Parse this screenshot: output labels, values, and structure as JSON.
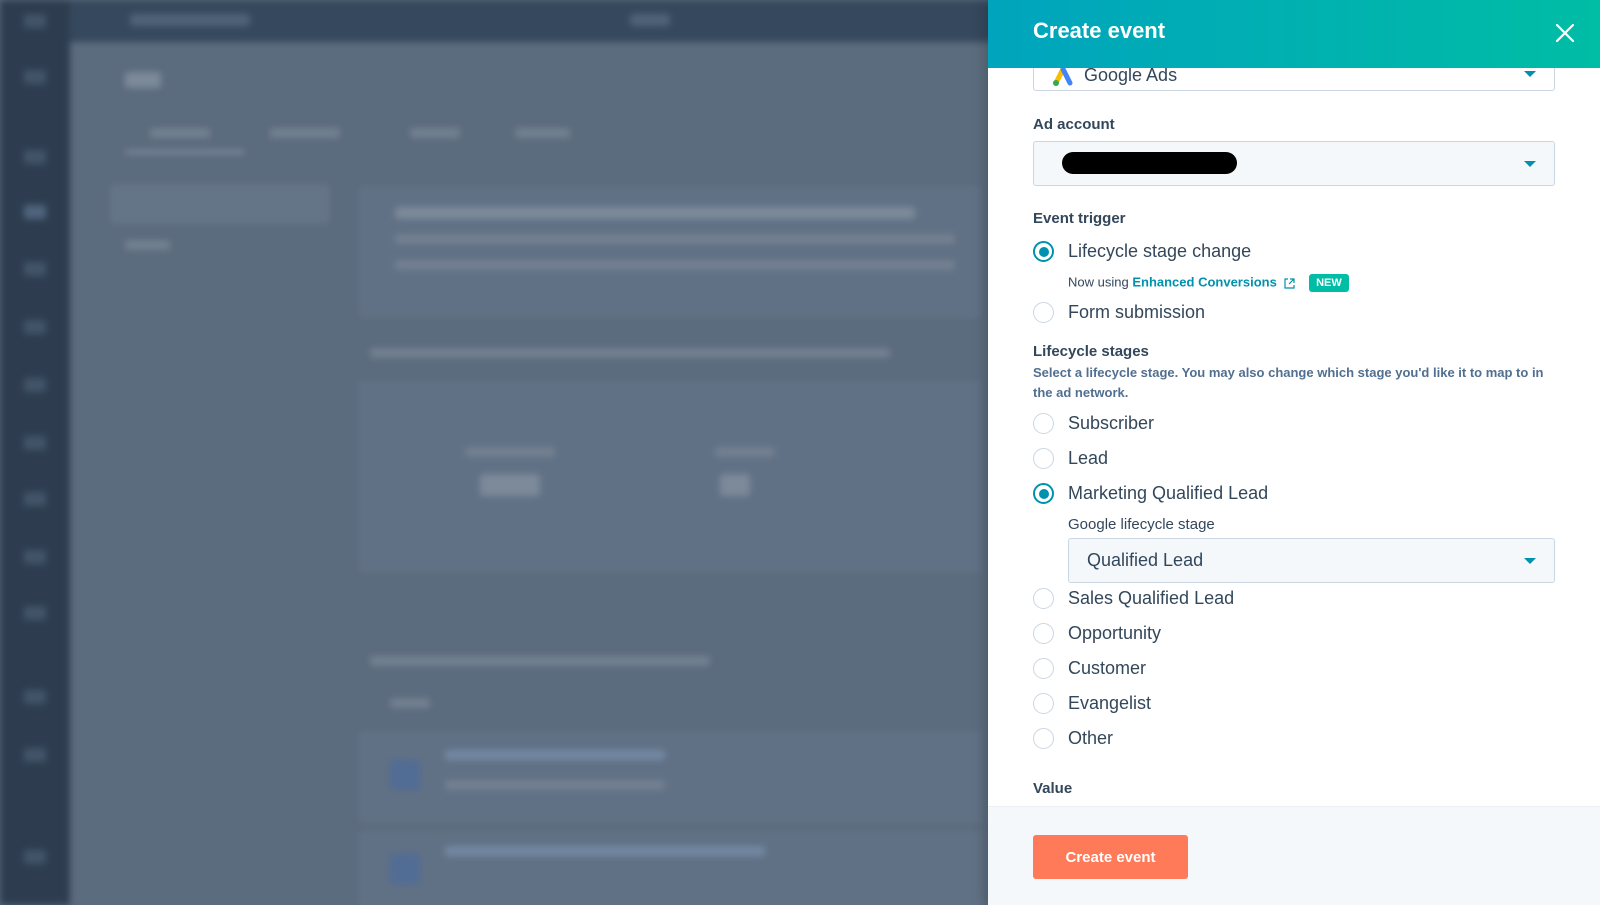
{
  "panel": {
    "title": "Create event",
    "ad_network_value": "Google Ads",
    "ad_account_label": "Ad account",
    "event_trigger_label": "Event trigger",
    "triggers": [
      {
        "label": "Lifecycle stage change",
        "checked": true
      },
      {
        "label": "Form submission",
        "checked": false
      }
    ],
    "enhanced_note": {
      "prefix": "Now using",
      "link": "Enhanced Conversions",
      "badge": "NEW"
    },
    "lifecycle_label": "Lifecycle stages",
    "lifecycle_helper": "Select a lifecycle stage. You may also change which stage you'd like it to map to in the ad network.",
    "stages": [
      {
        "label": "Subscriber",
        "checked": false
      },
      {
        "label": "Lead",
        "checked": false
      },
      {
        "label": "Marketing Qualified Lead",
        "checked": true
      },
      {
        "label": "Sales Qualified Lead",
        "checked": false
      },
      {
        "label": "Opportunity",
        "checked": false
      },
      {
        "label": "Customer",
        "checked": false
      },
      {
        "label": "Evangelist",
        "checked": false
      },
      {
        "label": "Other",
        "checked": false
      }
    ],
    "google_stage_label": "Google lifecycle stage",
    "google_stage_value": "Qualified Lead",
    "value_label": "Value",
    "submit_label": "Create event"
  },
  "colors": {
    "header_start": "#00a4bd",
    "header_end": "#00bda5",
    "accent": "#0091ae",
    "primary_button": "#ff7a59",
    "badge": "#00bda5"
  }
}
